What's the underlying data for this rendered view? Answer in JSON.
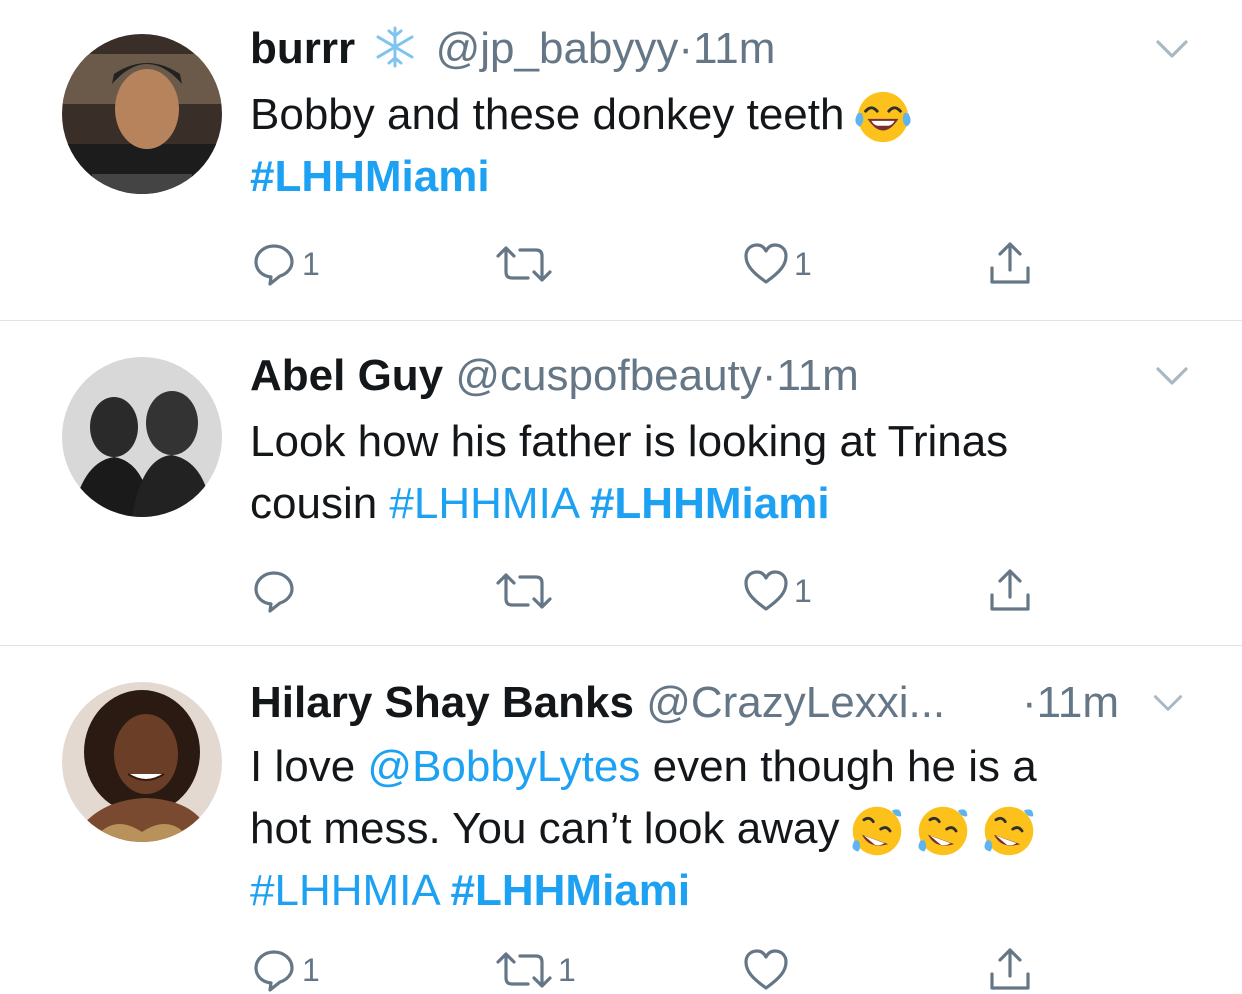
{
  "tweets": [
    {
      "name": "burrr",
      "handle": "@jp_babyyy",
      "dot": "·",
      "time": "11m",
      "text_lines": [
        "Bobby and these donkey teeth"
      ],
      "hashtags_line": [
        "#LHHMiami"
      ],
      "reply_count": "1",
      "retweet_count": "",
      "like_count": "1"
    },
    {
      "name": "Abel Guy",
      "handle": "@cuspofbeauty",
      "dot": "·",
      "time": "11m",
      "text_line1": "Look how his father is looking at Trinas",
      "text_line2_prefix": "cousin",
      "tag1": "#LHHMIA",
      "tag2": "#LHHMiami",
      "reply_count": "",
      "retweet_count": "",
      "like_count": "1"
    },
    {
      "name": "Hilary Shay Banks",
      "handle": "@CrazyLexxi...",
      "dot": "·",
      "time": "11m",
      "line1_prefix": "I love",
      "mention": "@BobbyLytes",
      "line1_suffix": "even though he is a",
      "line2": "hot mess. You can’t look away",
      "tag1": "#LHHMIA",
      "tag2": "#LHHMiami",
      "reply_count": "1",
      "retweet_count": "1",
      "like_count": ""
    }
  ],
  "colors": {
    "link": "#1da1f2",
    "muted": "#657786",
    "divider": "#dfe3e6"
  },
  "icons": [
    "snowflake-icon",
    "chevron-down-icon",
    "reply-icon",
    "retweet-icon",
    "like-icon",
    "share-icon",
    "joy-emoji",
    "rofl-emoji"
  ]
}
